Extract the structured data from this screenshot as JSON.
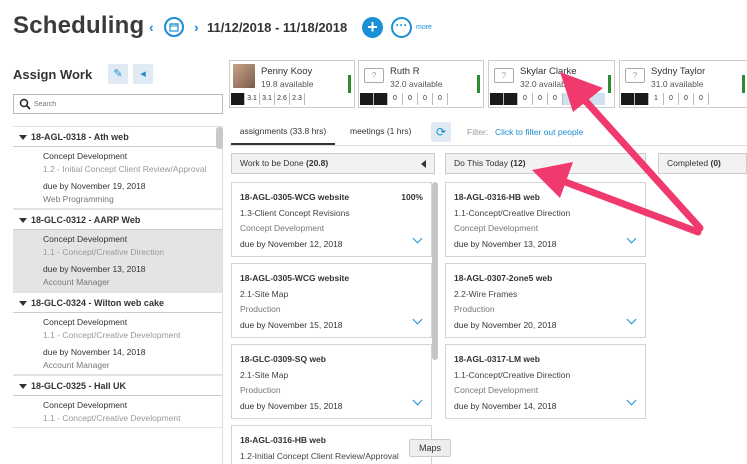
{
  "header": {
    "title": "Scheduling",
    "date_range": "11/12/2018 - 11/18/2018",
    "plus_label": "+",
    "more_dots": "···",
    "more_label": "more"
  },
  "left": {
    "title": "Assign Work",
    "search_placeholder": "Search",
    "groups": [
      {
        "name": "18-AGL-0318 - Ath web",
        "task": "Concept Development",
        "sub": "1.2 - Initial Concept Client Review/Approval",
        "due": "due by November 19, 2018",
        "role": "Web Programming"
      },
      {
        "name": "18-GLC-0312 - AARP Web",
        "task": "Concept Development",
        "sub": "1.1 - Concept/Creative Direction",
        "due": "due by November 13, 2018",
        "role": "Account Manager"
      },
      {
        "name": "18-GLC-0324 - Wilton web cake",
        "task": "Concept Development",
        "sub": "1.1 - Concept/Creative Development",
        "due": "due by November 14, 2018",
        "role": "Account Manager"
      },
      {
        "name": "18-GLC-0325 - Hall UK",
        "task": "Concept Development",
        "sub": "1.1 - Concept/Creative Development",
        "due": "",
        "role": ""
      }
    ]
  },
  "people": [
    {
      "name": "Penny Kooy",
      "available": "19.8 available",
      "hours": [
        "3.1",
        "3.1",
        "2.6",
        "2.3"
      ]
    },
    {
      "name": "Ruth R",
      "available": "32.0 available",
      "hours": [
        "0",
        "0",
        "0",
        "0"
      ]
    },
    {
      "name": "Skylar Clarke",
      "available": "32.0 available",
      "hours": [
        "0",
        "0",
        "0"
      ]
    },
    {
      "name": "Sydny Taylor",
      "available": "31.0 available",
      "hours": [
        "1",
        "0",
        "0",
        "0"
      ]
    }
  ],
  "tabs": {
    "assignments": "assignments (33.8 hrs)",
    "meetings": "meetings (1 hrs)",
    "filter_label": "Filter:",
    "filter_link": "Click to filter out people"
  },
  "columns": {
    "todo": {
      "label": "Work to be Done",
      "count": "(20.8)"
    },
    "today": {
      "label": "Do This Today",
      "count": "(12)"
    },
    "done": {
      "label": "Completed",
      "count": "(0)"
    }
  },
  "todo_cards": [
    {
      "job": "18-AGL-0305-WCG website",
      "pct": "100%",
      "task": "1.3-Client Concept Revisions",
      "phase": "Concept Development",
      "due": "due by November 12, 2018"
    },
    {
      "job": "18-AGL-0305-WCG website",
      "pct": "",
      "task": "2.1-Site Map",
      "phase": "Production",
      "due": "due by November 15, 2018"
    },
    {
      "job": "18-GLC-0309-SQ web",
      "pct": "",
      "task": "2.1-Site Map",
      "phase": "Production",
      "due": "due by November 15, 2018"
    },
    {
      "job": "18-AGL-0316-HB web",
      "pct": "",
      "task": "1.2-Initial Concept Client Review/Approval",
      "phase": "",
      "due": ""
    }
  ],
  "today_cards": [
    {
      "job": "18-AGL-0316-HB web",
      "task": "1.1-Concept/Creative Direction",
      "phase": "Concept Development",
      "due": "due by November 13, 2018"
    },
    {
      "job": "18-AGL-0307-2one5 web",
      "task": "2.2-Wire Frames",
      "phase": "Production",
      "due": "due by November 20, 2018"
    },
    {
      "job": "18-AGL-0317-LM web",
      "task": "1.1-Concept/Creative Direction",
      "phase": "Concept Development",
      "due": "due by November 14, 2018"
    }
  ],
  "tooltip": "Maps",
  "colors": {
    "accent": "#1b8fd6",
    "arrow": "#f03a6e",
    "available_bar": "#2e8b2e"
  }
}
